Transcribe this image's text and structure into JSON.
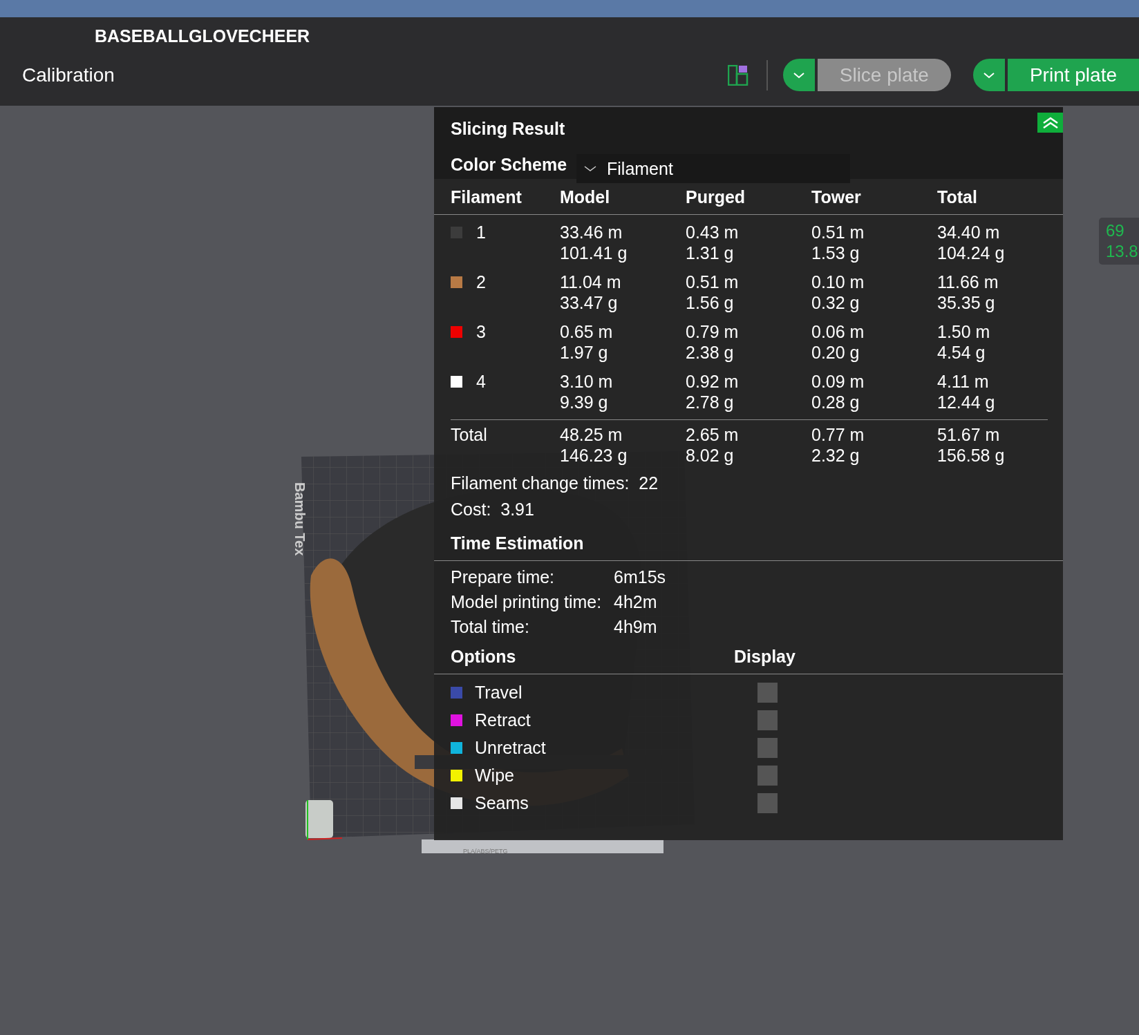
{
  "window": {
    "title": "BASEBALLGLOVECHEER"
  },
  "toolbar": {
    "tab": "Calibration",
    "slice_button": {
      "label": "Slice plate",
      "disabled": true
    },
    "print_button": {
      "label": "Print plate",
      "disabled": false
    }
  },
  "viewport": {
    "bed_label": "Bambu Tex",
    "plate_label": "PLA/ABS/PETG",
    "readout": [
      "69",
      "13.8"
    ]
  },
  "slicing_result": {
    "title": "Slicing Result",
    "color_scheme": {
      "label": "Color Scheme",
      "value": "Filament"
    },
    "columns": [
      "Filament",
      "Model",
      "Purged",
      "Tower",
      "Total"
    ],
    "rows": [
      {
        "filament": "1",
        "color": "#3c3c3c",
        "model": [
          "33.46 m",
          "101.41 g"
        ],
        "purged": [
          "0.43 m",
          "1.31 g"
        ],
        "tower": [
          "0.51 m",
          "1.53 g"
        ],
        "total": [
          "34.40 m",
          "104.24 g"
        ]
      },
      {
        "filament": "2",
        "color": "#b87a45",
        "model": [
          "11.04 m",
          "33.47 g"
        ],
        "purged": [
          "0.51 m",
          "1.56 g"
        ],
        "tower": [
          "0.10 m",
          "0.32 g"
        ],
        "total": [
          "11.66 m",
          "35.35 g"
        ]
      },
      {
        "filament": "3",
        "color": "#ee0000",
        "model": [
          "0.65 m",
          "1.97 g"
        ],
        "purged": [
          "0.79 m",
          "2.38 g"
        ],
        "tower": [
          "0.06 m",
          "0.20 g"
        ],
        "total": [
          "1.50 m",
          "4.54 g"
        ]
      },
      {
        "filament": "4",
        "color": "#ffffff",
        "model": [
          "3.10 m",
          "9.39 g"
        ],
        "purged": [
          "0.92 m",
          "2.78 g"
        ],
        "tower": [
          "0.09 m",
          "0.28 g"
        ],
        "total": [
          "4.11 m",
          "12.44 g"
        ]
      }
    ],
    "total_row": {
      "label": "Total",
      "model": [
        "48.25 m",
        "146.23 g"
      ],
      "purged": [
        "2.65 m",
        "8.02 g"
      ],
      "tower": [
        "0.77 m",
        "2.32 g"
      ],
      "total": [
        "51.67 m",
        "156.58 g"
      ]
    },
    "filament_change": {
      "label": "Filament change times:",
      "value": "22"
    },
    "cost": {
      "label": "Cost:",
      "value": "3.91"
    },
    "time_estimation": {
      "title": "Time Estimation",
      "items": [
        {
          "label": "Prepare time:",
          "value": "6m15s"
        },
        {
          "label": "Model printing time:",
          "value": "4h2m"
        },
        {
          "label": "Total time:",
          "value": "4h9m"
        }
      ]
    },
    "options": {
      "title": "Options",
      "display_title": "Display",
      "items": [
        {
          "label": "Travel",
          "color": "#3a4aa8",
          "checked": false
        },
        {
          "label": "Retract",
          "color": "#e012e0",
          "checked": false
        },
        {
          "label": "Unretract",
          "color": "#10b4dc",
          "checked": false
        },
        {
          "label": "Wipe",
          "color": "#f2f200",
          "checked": false
        },
        {
          "label": "Seams",
          "color": "#e6e6e6",
          "checked": false
        }
      ]
    }
  }
}
